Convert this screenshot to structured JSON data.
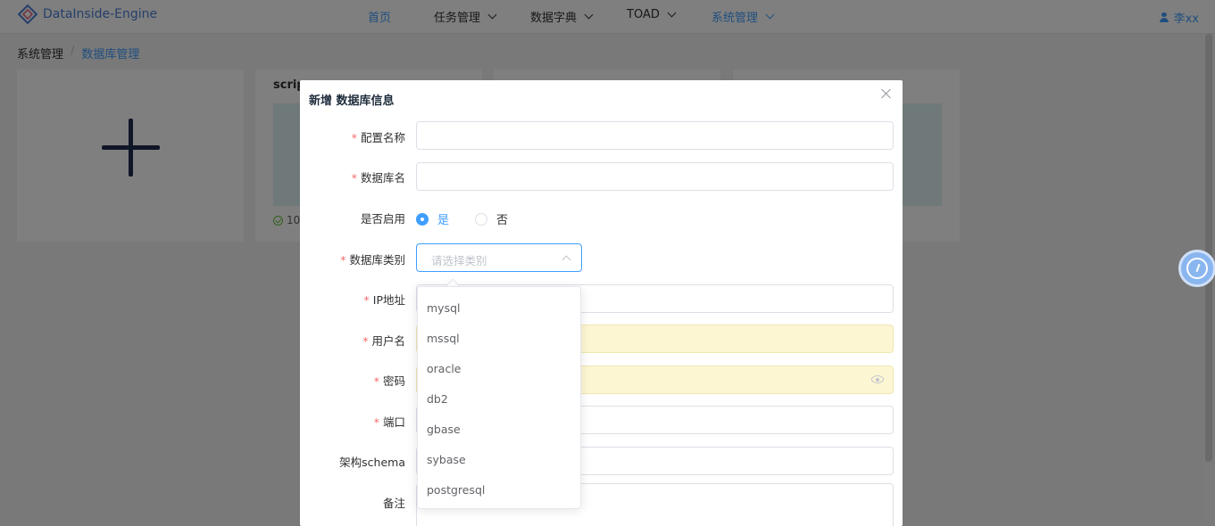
{
  "app": {
    "title": "DataInside-Engine"
  },
  "nav": {
    "items": [
      {
        "label": "首页"
      },
      {
        "label": "任务管理"
      },
      {
        "label": "数据字典"
      },
      {
        "label": "TOAD"
      },
      {
        "label": "系统管理"
      }
    ],
    "user": "李xx"
  },
  "breadcrumb": {
    "root": "系统管理",
    "sep": "/",
    "current": "数据库管理"
  },
  "cards": {
    "card2_title": "scrip",
    "card2_status": "10"
  },
  "dialog": {
    "title": "新增 数据库信息",
    "fields": {
      "config_name": "配置名称",
      "db_name": "数据库名",
      "enabled": "是否启用",
      "db_type": "数据库类别",
      "ip": "IP地址",
      "username": "用户名",
      "password": "密码",
      "port": "端口",
      "schema": "架构schema",
      "remark": "备注"
    },
    "radio": {
      "yes": "是",
      "no": "否"
    },
    "select_placeholder": "请选择类别",
    "options": [
      "mysql",
      "mssql",
      "oracle",
      "db2",
      "gbase",
      "sybase",
      "postgresql"
    ]
  },
  "colors": {
    "accent": "#409eff",
    "required": "#f56c6c",
    "autofill": "#fcf6d3"
  }
}
